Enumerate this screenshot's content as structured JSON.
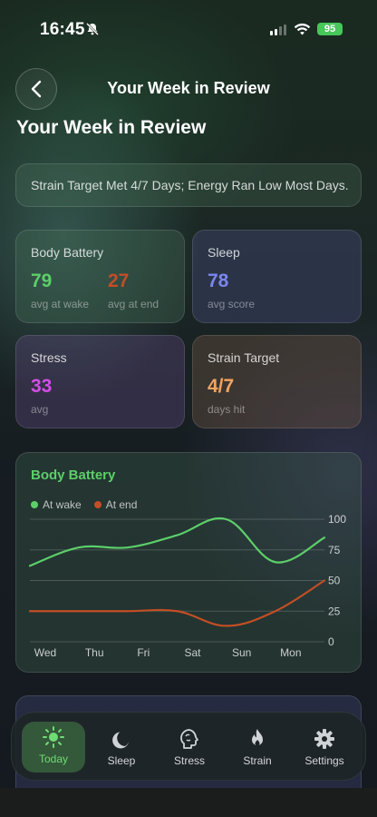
{
  "status": {
    "time": "16:45",
    "battery": "95"
  },
  "header": {
    "title": "Your Week in Review"
  },
  "page": {
    "title": "Your Week in Review"
  },
  "summary": "Strain Target Met 4/7 Days; Energy Ran Low Most Days.",
  "cards": {
    "body_battery": {
      "title": "Body Battery",
      "wake_value": "79",
      "wake_label": "avg at wake",
      "end_value": "27",
      "end_label": "avg at end"
    },
    "sleep": {
      "title": "Sleep",
      "value": "78",
      "label": "avg score"
    },
    "stress": {
      "title": "Stress",
      "value": "33",
      "label": "avg"
    },
    "strain": {
      "title": "Strain Target",
      "value": "4/7",
      "label": "days hit"
    }
  },
  "colors": {
    "green": "#5ccf69",
    "orange": "#c24e25",
    "blue": "#7b86ef",
    "magenta": "#d34de6",
    "amber": "#f4a460"
  },
  "chart_data": {
    "type": "line",
    "title": "Body Battery",
    "categories": [
      "Wed",
      "Thu",
      "Fri",
      "Sat",
      "Sun",
      "Mon",
      ""
    ],
    "y_ticks": [
      "100",
      "75",
      "50",
      "25",
      "0"
    ],
    "ylim": [
      0,
      100
    ],
    "legend_position": "top-left",
    "grid": true,
    "series": [
      {
        "name": "At wake",
        "color": "#5ccf69",
        "values": [
          62,
          77,
          77,
          87,
          100,
          65,
          85
        ]
      },
      {
        "name": "At end",
        "color": "#c24e25",
        "values": [
          25,
          25,
          25,
          25,
          13,
          25,
          50
        ]
      }
    ]
  },
  "tabs": [
    {
      "label": "Today",
      "icon": "sun-icon"
    },
    {
      "label": "Sleep",
      "icon": "moon-icon"
    },
    {
      "label": "Stress",
      "icon": "brain-icon"
    },
    {
      "label": "Strain",
      "icon": "flame-icon"
    },
    {
      "label": "Settings",
      "icon": "gear-icon"
    }
  ]
}
